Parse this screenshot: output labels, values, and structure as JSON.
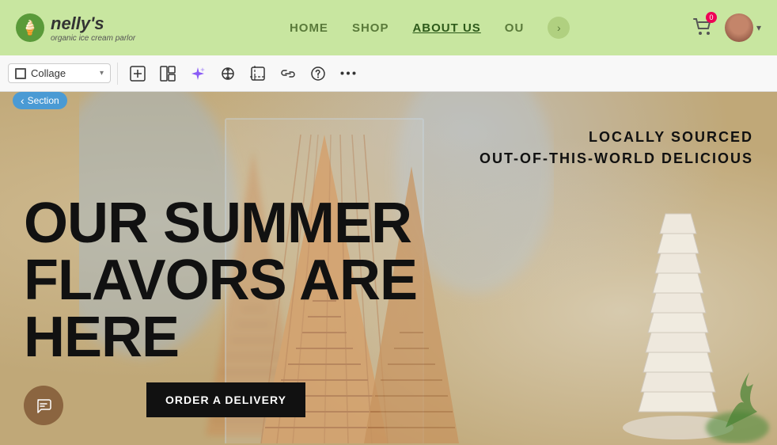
{
  "header": {
    "logo_name": "nelly's",
    "logo_sub": "organic ice cream parlor",
    "nav": {
      "items": [
        {
          "label": "HOME",
          "active": false
        },
        {
          "label": "SHOP",
          "active": false
        },
        {
          "label": "ABOUT US",
          "active": true
        },
        {
          "label": "OU",
          "active": false
        }
      ],
      "more_label": "›"
    },
    "cart_count": "0",
    "header_bg": "#c8e6a0"
  },
  "toolbar": {
    "collage_label": "Collage",
    "add_panel_title": "Add panel",
    "layout_title": "Change layout",
    "ai_title": "AI tools",
    "arrange_title": "Arrange",
    "crop_title": "Crop",
    "link_title": "Link",
    "help_title": "Help",
    "more_title": "More options"
  },
  "section_badge": {
    "label": "Section"
  },
  "hero": {
    "title_line1": "OUR SUMMER",
    "title_line2": "FLAVORS ARE",
    "title_line3": "HERE",
    "subtitle_line1": "LOCALLY SOURCED",
    "subtitle_line2": "OUT-OF-THIS-WORLD DELICIOUS",
    "cta_label": "ORDER A DELIVERY"
  },
  "colors": {
    "header_green": "#c8e6a0",
    "nav_green": "#5a7a3a",
    "section_blue": "#4a9ad4",
    "cta_dark": "#111111",
    "chat_brown": "#8b6540"
  }
}
